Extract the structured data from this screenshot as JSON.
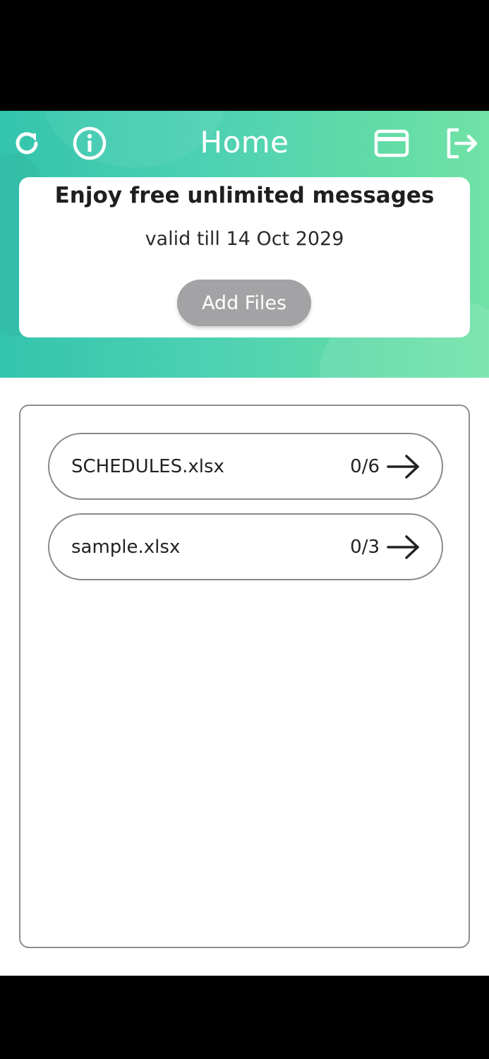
{
  "header": {
    "title": "Home",
    "icons": {
      "refresh": "refresh-icon",
      "info": "info-icon",
      "card": "credit-card-icon",
      "logout": "logout-icon"
    },
    "accent_gradient": [
      "#33c4ae",
      "#71e2a6"
    ]
  },
  "promo": {
    "headline": "Enjoy free unlimited messages",
    "subtitle": "valid till 14 Oct 2029",
    "add_files_label": "Add Files"
  },
  "files": [
    {
      "name": "SCHEDULES.xlsx",
      "count": "0/6"
    },
    {
      "name": "sample.xlsx",
      "count": "0/3"
    }
  ]
}
